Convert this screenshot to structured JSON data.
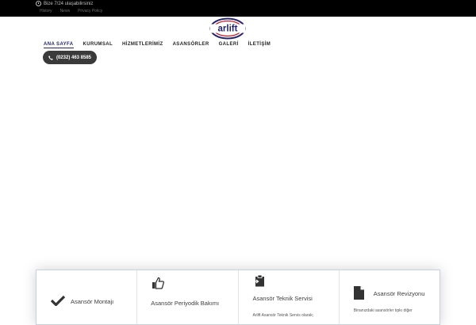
{
  "topbar": {
    "availability": "Bize 7/24 ulaşabilirsiniz",
    "links": [
      "History",
      "News",
      "Privacy Policy"
    ]
  },
  "logo": {
    "text": "arlift"
  },
  "nav": {
    "items": [
      "ANA SAYFA",
      "KURUMSAL",
      "HİZMETLERİMİZ",
      "ASANSÖRLER",
      "GALERİ",
      "İLETİŞİM"
    ]
  },
  "phone": {
    "label": "(0232) 463 8585"
  },
  "features": [
    {
      "title": "Asansör Montajı",
      "icon": "check-icon"
    },
    {
      "title": "Asansör Periyodik Bakımı",
      "icon": "thumbs-up-icon"
    },
    {
      "title": "Asansör Teknik Servisi",
      "icon": "clipboard-icon",
      "desc": "Arlift Asansör Teknik Servis olarak;"
    },
    {
      "title": "Asansör Revizyonu",
      "icon": "document-icon",
      "desc": "Binanızdaki asansörler tıpkı diğer"
    }
  ],
  "colors": {
    "brand_blue": "#24246e",
    "brand_red": "#c4161c",
    "topbar": "#000000",
    "phone_button": "#3a3a3a"
  }
}
